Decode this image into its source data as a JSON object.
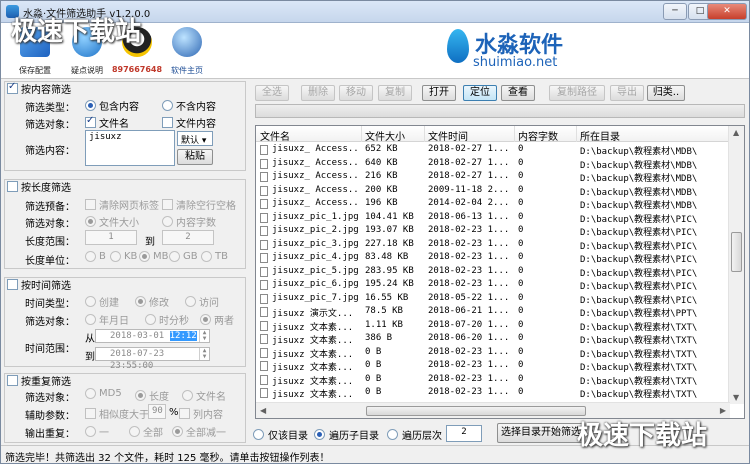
{
  "window": {
    "title": "水淼·文件筛选助手 v1.2.0.0",
    "min": "─",
    "max": "□",
    "close": "✕"
  },
  "header": {
    "tools": [
      {
        "label": "保存配置",
        "icon": "save-icon",
        "color": "#2f7fd6"
      },
      {
        "label": "疑点说明",
        "icon": "help-icon",
        "color": "#2d8fd8"
      },
      {
        "label": "897667648",
        "icon": "qq-icon",
        "color": "#1a1a1a"
      },
      {
        "label": "软件主页",
        "icon": "globe-icon",
        "color": "#3b6fb6"
      }
    ],
    "brand_cn": "水淼软件",
    "brand_en": "shuimiao.net",
    "watermark": "极速下载站"
  },
  "content_filter": {
    "title": "按内容筛选",
    "type_label": "筛选类型：",
    "type_options": [
      "包含内容",
      "不含内容"
    ],
    "object_label": "筛选对象：",
    "object_options": [
      "文件名",
      "文件内容"
    ],
    "content_label": "筛选内容：",
    "content_value": "jisuxz",
    "default_select": "默认",
    "paste_button": "粘贴"
  },
  "length_filter": {
    "title": "按长度筛选",
    "preset_label": "筛选预备：",
    "preset_options": [
      "清除网页标签",
      "清除空行空格"
    ],
    "object_label": "筛选对象：",
    "object_options": [
      "文件大小",
      "内容字数"
    ],
    "range_label": "长度范围：",
    "range_from": "1",
    "range_to_label": "到",
    "range_to": "2",
    "unit_label": "长度单位：",
    "unit_options": [
      "B",
      "KB",
      "MB",
      "GB",
      "TB"
    ]
  },
  "time_filter": {
    "title": "按时间筛选",
    "type_label": "时间类型：",
    "type_options": [
      "创建",
      "修改",
      "访问"
    ],
    "object_label": "筛选对象：",
    "object_options": [
      "年月日",
      "时分秒",
      "两者"
    ],
    "range_label": "时间范围：",
    "from_label": "从",
    "from_value": "2018-03-01",
    "from_time": "12:12",
    "to_label": "到",
    "to_value": "2018-07-23 23:55:00"
  },
  "dup_filter": {
    "title": "按重复筛选",
    "object_label": "筛选对象：",
    "object_options": [
      "MD5",
      "长度",
      "文件名"
    ],
    "aux_label": "辅助参数：",
    "aux_option1": "相似度大于",
    "aux_value": "90",
    "aux_unit": "%",
    "aux_option2": "列内容",
    "output_label": "输出重复：",
    "output_options": [
      "一",
      "全部",
      "全部减一"
    ]
  },
  "toolbar": {
    "buttons": [
      "全选",
      "删除",
      "移动",
      "复制",
      "打开",
      "定位",
      "查看",
      "复制路径",
      "导出",
      "归类.."
    ]
  },
  "list": {
    "columns": [
      "文件名",
      "文件大小",
      "文件时间",
      "内容字数",
      "所在目录"
    ],
    "rows": [
      [
        "jisuxz_ Access...",
        "652 KB",
        "2018-02-27 1...",
        "0",
        "D:\\backup\\教程素材\\MDB\\"
      ],
      [
        "jisuxz_ Access...",
        "640 KB",
        "2018-02-27 1...",
        "0",
        "D:\\backup\\教程素材\\MDB\\"
      ],
      [
        "jisuxz_ Access...",
        "216 KB",
        "2018-02-27 1...",
        "0",
        "D:\\backup\\教程素材\\MDB\\"
      ],
      [
        "jisuxz_ Access...",
        "200 KB",
        "2009-11-18 2...",
        "0",
        "D:\\backup\\教程素材\\MDB\\"
      ],
      [
        "jisuxz_ Access...",
        "196 KB",
        "2014-02-04 2...",
        "0",
        "D:\\backup\\教程素材\\MDB\\"
      ],
      [
        "jisuxz_pic_1.jpg",
        "104.41 KB",
        "2018-06-13 1...",
        "0",
        "D:\\backup\\教程素材\\PIC\\"
      ],
      [
        "jisuxz_pic_2.jpg",
        "193.07 KB",
        "2018-02-23 1...",
        "0",
        "D:\\backup\\教程素材\\PIC\\"
      ],
      [
        "jisuxz_pic_3.jpg",
        "227.18 KB",
        "2018-02-23 1...",
        "0",
        "D:\\backup\\教程素材\\PIC\\"
      ],
      [
        "jisuxz_pic_4.jpg",
        "83.48 KB",
        "2018-02-23 1...",
        "0",
        "D:\\backup\\教程素材\\PIC\\"
      ],
      [
        "jisuxz_pic_5.jpg",
        "283.95 KB",
        "2018-02-23 1...",
        "0",
        "D:\\backup\\教程素材\\PIC\\"
      ],
      [
        "jisuxz_pic_6.jpg",
        "195.24 KB",
        "2018-02-23 1...",
        "0",
        "D:\\backup\\教程素材\\PIC\\"
      ],
      [
        "jisuxz_pic_7.jpg",
        "16.55 KB",
        "2018-05-22 1...",
        "0",
        "D:\\backup\\教程素材\\PIC\\"
      ],
      [
        "jisuxz 演示文...",
        "78.5 KB",
        "2018-06-21 1...",
        "0",
        "D:\\backup\\教程素材\\PPT\\"
      ],
      [
        "jisuxz 文本素...",
        "1.11 KB",
        "2018-07-20 1...",
        "0",
        "D:\\backup\\教程素材\\TXT\\"
      ],
      [
        "jisuxz 文本素...",
        "386 B",
        "2018-06-20 1...",
        "0",
        "D:\\backup\\教程素材\\TXT\\"
      ],
      [
        "jisuxz 文本素...",
        "0 B",
        "2018-02-23 1...",
        "0",
        "D:\\backup\\教程素材\\TXT\\"
      ],
      [
        "jisuxz 文本素...",
        "0 B",
        "2018-02-23 1...",
        "0",
        "D:\\backup\\教程素材\\TXT\\"
      ],
      [
        "jisuxz 文本素...",
        "0 B",
        "2018-02-23 1...",
        "0",
        "D:\\backup\\教程素材\\TXT\\"
      ],
      [
        "jisuxz 文本素...",
        "0 B",
        "2018-02-23 1...",
        "0",
        "D:\\backup\\教程素材\\TXT\\"
      ]
    ]
  },
  "bottom": {
    "scope_options": [
      "仅该目录",
      "遍历子目录",
      "遍历层次"
    ],
    "depth_value": "2",
    "start_button": "选择目录开始筛选"
  },
  "status": "筛选完毕！共筛选出 32 个文件，耗时 125 毫秒。请单击按钮操作列表！"
}
